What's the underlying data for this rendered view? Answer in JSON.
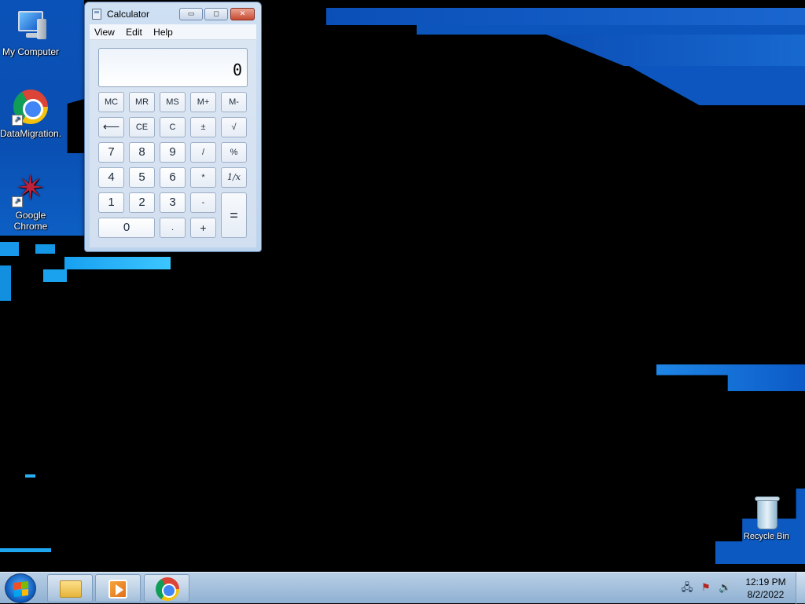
{
  "desktop": {
    "icons": [
      {
        "label": "My Computer",
        "icon": "computer-icon"
      },
      {
        "label": "DataMigration...",
        "icon": "chrome-shortcut-icon"
      },
      {
        "label": "Google Chrome",
        "icon": "star-shortcut-icon"
      },
      {
        "label": "Recycle Bin",
        "icon": "recycle-bin-icon"
      }
    ]
  },
  "calculator": {
    "title": "Calculator",
    "menu": [
      "View",
      "Edit",
      "Help"
    ],
    "display": "0",
    "keys": {
      "mc": "MC",
      "mr": "MR",
      "ms": "MS",
      "mplus": "M+",
      "mminus": "M-",
      "back": "⟵",
      "ce": "CE",
      "c": "C",
      "plusminus": "±",
      "sqrt": "√",
      "k7": "7",
      "k8": "8",
      "k9": "9",
      "div": "/",
      "pct": "%",
      "k4": "4",
      "k5": "5",
      "k6": "6",
      "mul": "*",
      "recip": "1/x",
      "k1": "1",
      "k2": "2",
      "k3": "3",
      "sub": "-",
      "eq": "=",
      "k0": "0",
      "dot": ".",
      "add": "+"
    },
    "window_buttons": {
      "min": "▭",
      "max": "◻",
      "close": "✕"
    }
  },
  "taskbar": {
    "items": [
      "Windows Explorer",
      "Windows Media Player",
      "Google Chrome"
    ],
    "clock": {
      "time": "12:19 PM",
      "date": "8/2/2022"
    },
    "tray": [
      "network-icon",
      "action-center-icon",
      "volume-icon"
    ]
  }
}
